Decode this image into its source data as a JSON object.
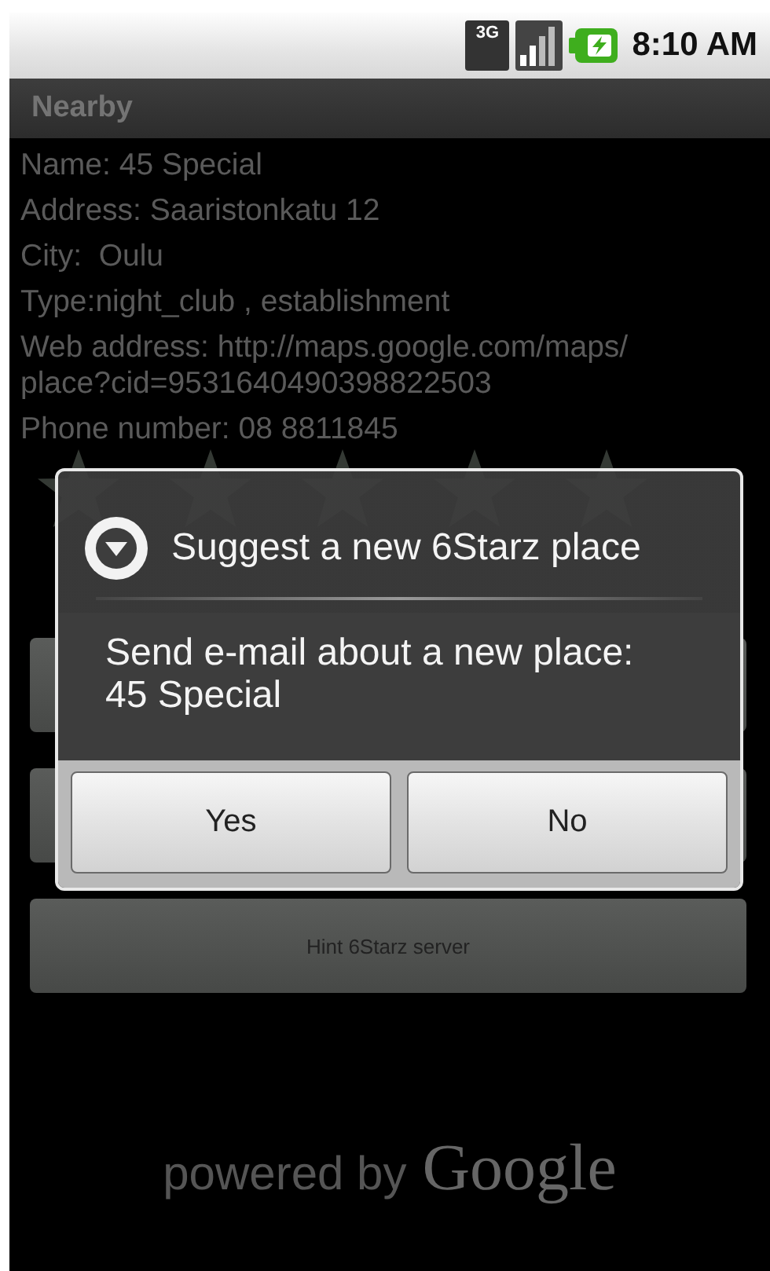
{
  "status_bar": {
    "time": "8:10 AM",
    "network": "3G"
  },
  "title_bar": {
    "title": "Nearby"
  },
  "details": [
    "Name: 45 Special",
    "Address: Saaristonkatu 12",
    "City:  Oulu",
    "Type:night_club , establishment",
    "Web address: http://maps.google.com/maps/place?cid=9531640490398822503",
    "Phone number: 08 8811845"
  ],
  "rating": {
    "stars": 0
  },
  "buttons": [
    {
      "label": "Hint 6Starz server"
    }
  ],
  "footer": {
    "prefix": "powered by",
    "brand": "Google"
  },
  "dialog": {
    "title": "Suggest a new 6Starz place",
    "message": "Send e-mail about a new place:\n45 Special",
    "buttons": [
      {
        "label": "Yes"
      },
      {
        "label": "No"
      }
    ]
  }
}
